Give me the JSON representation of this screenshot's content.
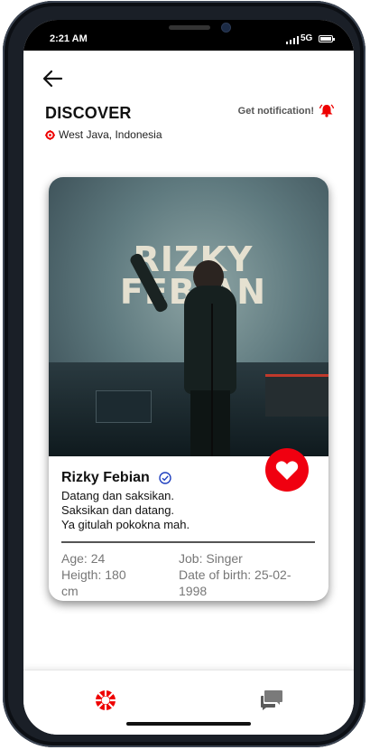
{
  "status": {
    "time": "2:21 AM",
    "network": "5G"
  },
  "header": {
    "title": "DISCOVER",
    "location": "West Java, Indonesia",
    "notification_label": "Get notification!"
  },
  "card": {
    "photo_text_line1": "RIZKY",
    "photo_text_line2": "FEBIAN",
    "name": "Rizky Febian",
    "verified": true,
    "bio": [
      "Datang dan saksikan.",
      "Saksikan dan datang.",
      "Ya gitulah pokokna mah."
    ],
    "age": "Age: 24",
    "height_line1": "Heigth: 180",
    "height_line2": "cm",
    "job": "Job: Singer",
    "dob_line1": "Date of birth: 25-02-",
    "dob_line2": "1998"
  },
  "colors": {
    "accent": "#f00010",
    "verified": "#1f3fbf"
  },
  "icons": [
    "back-arrow-icon",
    "location-pin-icon",
    "bell-icon",
    "heart-icon",
    "verified-check-icon",
    "discover-icon",
    "chat-icon"
  ]
}
